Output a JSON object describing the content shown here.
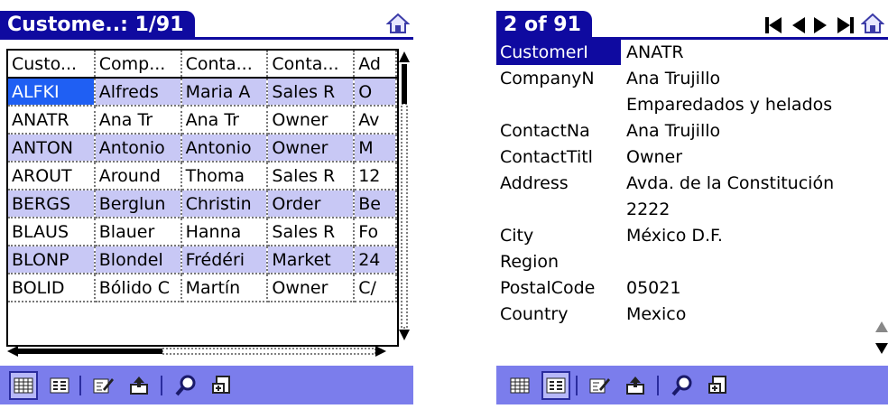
{
  "left": {
    "title": "Custome..: 1/91",
    "grid": {
      "headers": [
        "Custo...",
        "Comp...",
        "Conta...",
        "Conta...",
        "Ad"
      ],
      "rows": [
        [
          "ALFKI",
          "Alfreds",
          "Maria A",
          "Sales R",
          "O"
        ],
        [
          "ANATR",
          "Ana Tr",
          "Ana Tr",
          "Owner",
          "Av"
        ],
        [
          "ANTON",
          "Antonio",
          "Antonio",
          "Owner",
          "M"
        ],
        [
          "AROUT",
          "Around",
          "Thoma",
          "Sales R",
          "12"
        ],
        [
          "BERGS",
          "Berglun",
          "Christin",
          "Order",
          "Be"
        ],
        [
          "BLAUS",
          "Blauer",
          "Hanna",
          "Sales R",
          "Fo"
        ],
        [
          "BLONP",
          "Blondel",
          "Frédéri",
          "Market",
          "24"
        ],
        [
          "BOLID",
          "Bólido C",
          "Martín",
          "Owner",
          "C/"
        ]
      ]
    }
  },
  "right": {
    "title": "2 of 91",
    "fields": [
      {
        "label": "CustomerI",
        "value": "ANATR"
      },
      {
        "label": "CompanyN",
        "value": "Ana Trujillo"
      },
      {
        "label": "",
        "value": "Emparedados y helados"
      },
      {
        "label": "ContactNa",
        "value": "Ana Trujillo"
      },
      {
        "label": "ContactTitl",
        "value": "Owner"
      },
      {
        "label": "Address",
        "value": "Avda. de la Constitución"
      },
      {
        "label": "",
        "value": "2222"
      },
      {
        "label": "City",
        "value": "México D.F."
      },
      {
        "label": "Region",
        "value": ""
      },
      {
        "label": "PostalCode",
        "value": "05021"
      },
      {
        "label": "Country",
        "value": "Mexico"
      }
    ]
  },
  "colors": {
    "title_bar": "#0f0aa0",
    "selection": "#1f5ff3",
    "alt_row": "#c8c8f5",
    "toolbar": "#7b7dec"
  },
  "icons": [
    "home-icon",
    "table-view-icon",
    "record-view-icon",
    "edit-icon",
    "up-folder-icon",
    "search-icon",
    "export-icon",
    "first-record-icon",
    "prev-record-icon",
    "next-record-icon",
    "last-record-icon"
  ]
}
